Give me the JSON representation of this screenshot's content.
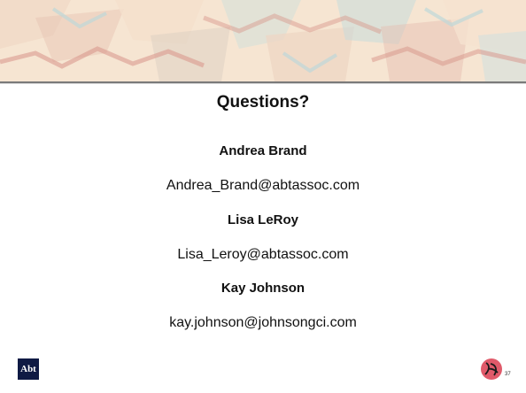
{
  "slide": {
    "title": "Questions?",
    "contacts": [
      {
        "name": "Andrea Brand",
        "email": "Andrea_Brand@abtassoc.com"
      },
      {
        "name": "Lisa LeRoy",
        "email": "Lisa_Leroy@abtassoc.com"
      },
      {
        "name": "Kay Johnson",
        "email": "kay.johnson@johnsongci.com"
      }
    ],
    "footer": {
      "logo_text": "Abt",
      "page_number": "37"
    }
  },
  "colors": {
    "banner_base": "#f3dcc0",
    "banner_red": "#c25a4a",
    "banner_teal": "#9bc3c5",
    "logo_navy": "#0f1a44",
    "seal_red": "#e05a6a"
  }
}
